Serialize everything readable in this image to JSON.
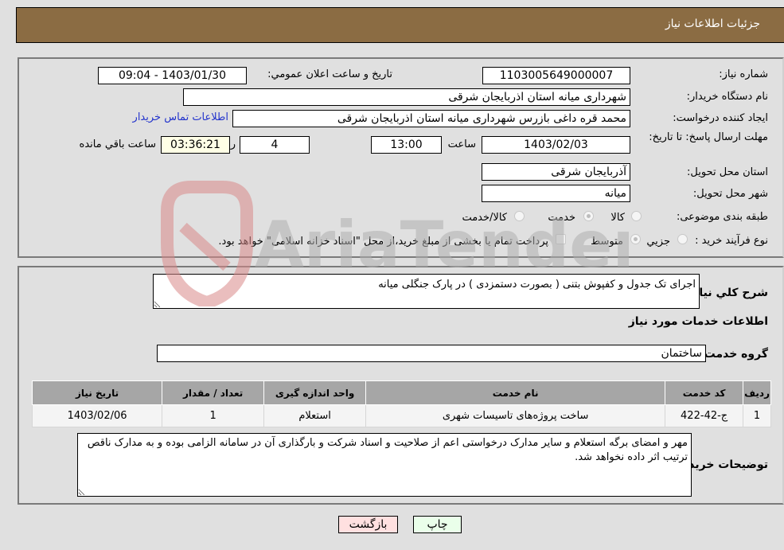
{
  "header": {
    "title": "جزئیات اطلاعات نیاز"
  },
  "details": {
    "need_number": {
      "label": "شماره نیاز:",
      "value": "1103005649000007"
    },
    "announce_datetime": {
      "label": "تاریخ و ساعت اعلان عمومي:",
      "value": "1403/01/30 - 09:04"
    },
    "buyer_org": {
      "label": "نام دستگاه خریدار:",
      "value": "شهرداری میانه استان اذربایجان شرقی"
    },
    "requester": {
      "label": "ایجاد کننده درخواست:",
      "value": "محمد قره داغی بازرس شهرداری میانه استان اذربایجان شرقی"
    },
    "buyer_contact_link": "اطلاعات تماس خریدار",
    "deadline": {
      "label": "مهلت ارسال پاسخ: تا تاریخ:",
      "date": "1403/02/03",
      "time_label": "ساعت",
      "time": "13:00",
      "days": "4",
      "days_label": "روز و",
      "remaining": "03:36:21",
      "remaining_label": "ساعت باقي مانده"
    },
    "province": {
      "label": "استان محل تحویل:",
      "value": "آذربایجان شرقی"
    },
    "city": {
      "label": "شهر محل تحویل:",
      "value": "میانه"
    },
    "category": {
      "label": "طبقه بندی موضوعی:",
      "options": [
        "کالا",
        "خدمت",
        "کالا/خدمت"
      ],
      "selected": "خدمت"
    },
    "purchase_process": {
      "label": "نوع فرآیند خرید :",
      "options": [
        "جزيي",
        "متوسط"
      ],
      "selected": "متوسط",
      "treasury_note": "پرداخت تمام یا بخشی از مبلغ خرید،از محل \"اسناد خزانه اسلامی\" خواهد بود."
    }
  },
  "description": {
    "label": "شرح کلي نياز:",
    "value": "اجرای تک جدول و کفپوش بتنی ( بصورت دستمزدی ) در پارک جنگلی میانه"
  },
  "services_section": {
    "title": "اطلاعات خدمات مورد نیاز",
    "group_label": "گروه خدمت:",
    "group_value": "ساختمان",
    "columns": [
      "ردیف",
      "کد خدمت",
      "نام خدمت",
      "واحد اندازه گیری",
      "تعداد / مقدار",
      "تاریخ نیاز"
    ],
    "rows": [
      {
        "index": "1",
        "code": "ج-42-422",
        "name": "ساخت پروژه‌های تاسیسات شهری",
        "unit": "استعلام",
        "quantity": "1",
        "date": "1403/02/06"
      }
    ]
  },
  "buyer_notes": {
    "label": "توضیحات خریدار:",
    "value": "مهر و امضای برگه استعلام و سایر مدارک درخواستی اعم از صلاحیت و اسناد شرکت و بارگذاری آن در سامانه الزامی بوده و به مدارک ناقص ترتیب اثر داده نخواهد شد."
  },
  "buttons": {
    "print": "چاپ",
    "back": "بازگشت"
  },
  "watermark": {
    "text": "AriaTender.neT"
  }
}
